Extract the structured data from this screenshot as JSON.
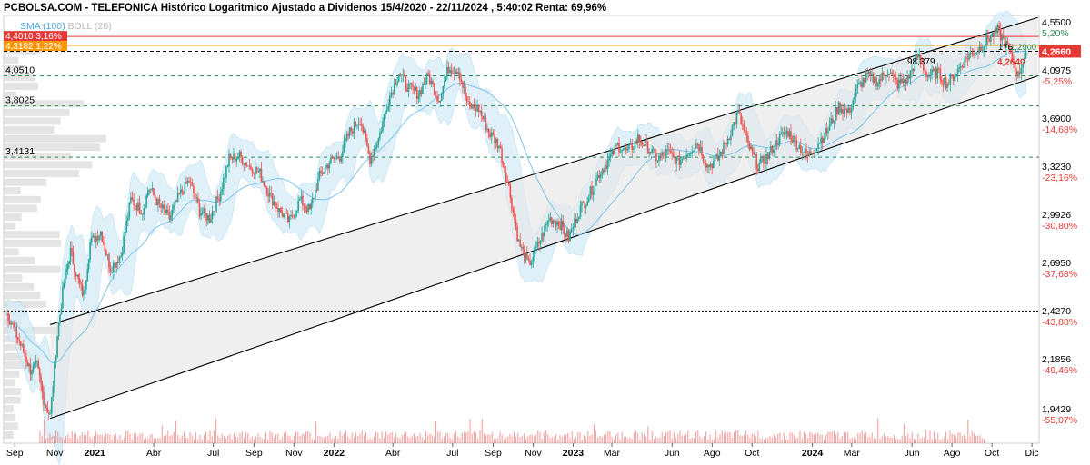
{
  "title": "PCBOLSA.COM - TELEFONICA Histórico Logaritmico Ajustado a Dividenos 15/4/2020 - 22/11/2024 , 5:40:02 Renta: 69,96%",
  "legend": {
    "sma": "SMA (100)",
    "boll": "BOLL (20)"
  },
  "colors": {
    "up": "#26a69a",
    "down": "#ef5350",
    "sma": "#7cc4ec",
    "boll_fill": "#d6ecf8",
    "channel_fill": "#e6e6e6",
    "channel_line": "#000000",
    "support_line": "#2e8b57",
    "resistance_line": "#e53935",
    "orange_label": "#ff9800",
    "last_price_bg": "#e53935",
    "volume": "#ef5350",
    "histogram": "#d9d9d9"
  },
  "chart_data": {
    "type": "candlestick",
    "scale": "log",
    "ylim": [
      1.87,
      4.6
    ],
    "x_tick_labels": [
      "Sep",
      "Nov",
      "2021",
      "Abr",
      "Jul",
      "Sep",
      "Nov",
      "2022",
      "Abr",
      "Jul",
      "Sep",
      "Nov",
      "2023",
      "Mar",
      "Jun",
      "Ago",
      "Oct",
      "2024",
      "Mar",
      "Jun",
      "Ago",
      "Oct",
      "Dic"
    ],
    "y_price_labels": [
      "4,5500",
      "4,0975",
      "3,6900",
      "3,3230",
      "2,9926",
      "2,6950",
      "2,4270",
      "2,1856",
      "1,9429"
    ],
    "y_pct_labels": [
      "5,20%",
      "-5,25%",
      "-14,68%",
      "-23,16%",
      "-30,80%",
      "-37,68%",
      "-43,88%",
      "-49,46%",
      "-55,07%"
    ],
    "left_level_labels": [
      "4,0510",
      "3,8025",
      "3,4131"
    ],
    "top_left_labels": [
      "4,4010  3,16%",
      "4,3182  1,22%"
    ],
    "last_price": "4,2660",
    "right_annotations": [
      "176",
      "1,2900",
      "4,2640"
    ],
    "mid_annotation": "98,379",
    "price_path": [
      [
        "2020-08-20",
        2.46
      ],
      [
        "2020-09-10",
        2.3
      ],
      [
        "2020-09-25",
        2.18
      ],
      [
        "2020-10-05",
        2.2
      ],
      [
        "2020-10-15",
        2.05
      ],
      [
        "2020-10-25",
        1.98
      ],
      [
        "2020-11-05",
        2.35
      ],
      [
        "2020-11-15",
        2.62
      ],
      [
        "2020-11-25",
        2.8
      ],
      [
        "2020-12-05",
        2.65
      ],
      [
        "2020-12-15",
        2.55
      ],
      [
        "2020-12-25",
        2.85
      ],
      [
        "2021-01-10",
        2.92
      ],
      [
        "2021-01-25",
        2.7
      ],
      [
        "2021-02-10",
        2.78
      ],
      [
        "2021-02-25",
        3.12
      ],
      [
        "2021-03-15",
        3.05
      ],
      [
        "2021-03-25",
        3.2
      ],
      [
        "2021-04-10",
        3.08
      ],
      [
        "2021-04-25",
        3.0
      ],
      [
        "2021-05-10",
        3.15
      ],
      [
        "2021-05-25",
        3.25
      ],
      [
        "2021-06-10",
        3.05
      ],
      [
        "2021-06-25",
        3.0
      ],
      [
        "2021-07-10",
        3.15
      ],
      [
        "2021-07-25",
        3.4
      ],
      [
        "2021-08-10",
        3.42
      ],
      [
        "2021-08-25",
        3.35
      ],
      [
        "2021-09-10",
        3.3
      ],
      [
        "2021-09-25",
        3.15
      ],
      [
        "2021-10-10",
        3.05
      ],
      [
        "2021-10-25",
        2.98
      ],
      [
        "2021-11-10",
        3.12
      ],
      [
        "2021-11-25",
        3.05
      ],
      [
        "2021-12-10",
        3.28
      ],
      [
        "2021-12-25",
        3.38
      ],
      [
        "2022-01-10",
        3.42
      ],
      [
        "2022-01-25",
        3.6
      ],
      [
        "2022-02-10",
        3.7
      ],
      [
        "2022-02-25",
        3.4
      ],
      [
        "2022-03-10",
        3.55
      ],
      [
        "2022-03-25",
        3.85
      ],
      [
        "2022-04-10",
        4.08
      ],
      [
        "2022-04-25",
        3.95
      ],
      [
        "2022-05-10",
        3.9
      ],
      [
        "2022-05-25",
        4.05
      ],
      [
        "2022-06-10",
        3.85
      ],
      [
        "2022-06-25",
        4.12
      ],
      [
        "2022-07-10",
        4.1
      ],
      [
        "2022-07-25",
        3.8
      ],
      [
        "2022-08-10",
        3.78
      ],
      [
        "2022-08-25",
        3.6
      ],
      [
        "2022-09-10",
        3.5
      ],
      [
        "2022-09-25",
        3.2
      ],
      [
        "2022-10-10",
        2.85
      ],
      [
        "2022-10-25",
        2.72
      ],
      [
        "2022-11-10",
        2.85
      ],
      [
        "2022-11-25",
        3.0
      ],
      [
        "2022-12-10",
        2.98
      ],
      [
        "2022-12-25",
        2.88
      ],
      [
        "2023-01-10",
        3.05
      ],
      [
        "2023-01-25",
        3.15
      ],
      [
        "2023-02-10",
        3.3
      ],
      [
        "2023-02-25",
        3.4
      ],
      [
        "2023-03-10",
        3.5
      ],
      [
        "2023-03-25",
        3.45
      ],
      [
        "2023-04-10",
        3.55
      ],
      [
        "2023-04-25",
        3.48
      ],
      [
        "2023-05-10",
        3.4
      ],
      [
        "2023-05-25",
        3.45
      ],
      [
        "2023-06-10",
        3.38
      ],
      [
        "2023-06-25",
        3.45
      ],
      [
        "2023-07-10",
        3.52
      ],
      [
        "2023-07-25",
        3.35
      ],
      [
        "2023-08-10",
        3.4
      ],
      [
        "2023-08-25",
        3.55
      ],
      [
        "2023-09-10",
        3.75
      ],
      [
        "2023-09-25",
        3.5
      ],
      [
        "2023-10-10",
        3.35
      ],
      [
        "2023-10-25",
        3.42
      ],
      [
        "2023-11-10",
        3.55
      ],
      [
        "2023-11-25",
        3.6
      ],
      [
        "2023-12-10",
        3.5
      ],
      [
        "2023-12-25",
        3.42
      ],
      [
        "2024-01-10",
        3.52
      ],
      [
        "2024-01-25",
        3.62
      ],
      [
        "2024-02-10",
        3.8
      ],
      [
        "2024-02-25",
        3.75
      ],
      [
        "2024-03-10",
        3.95
      ],
      [
        "2024-03-25",
        4.05
      ],
      [
        "2024-04-10",
        4.0
      ],
      [
        "2024-04-25",
        4.1
      ],
      [
        "2024-05-10",
        3.98
      ],
      [
        "2024-05-25",
        4.02
      ],
      [
        "2024-06-10",
        4.22
      ],
      [
        "2024-06-25",
        4.05
      ],
      [
        "2024-07-10",
        4.08
      ],
      [
        "2024-07-25",
        3.98
      ],
      [
        "2024-08-10",
        4.1
      ],
      [
        "2024-08-25",
        4.22
      ],
      [
        "2024-09-10",
        4.28
      ],
      [
        "2024-09-25",
        4.38
      ],
      [
        "2024-10-10",
        4.45
      ],
      [
        "2024-10-25",
        4.3
      ],
      [
        "2024-11-10",
        4.05
      ],
      [
        "2024-11-22",
        4.27
      ]
    ],
    "channel": {
      "lower": [
        [
          "2020-10-25",
          1.97
        ],
        [
          "2024-12-10",
          4.05
        ]
      ],
      "upper": [
        [
          "2020-10-25",
          2.4
        ],
        [
          "2024-12-10",
          4.58
        ]
      ]
    },
    "horizontal_levels": [
      {
        "value": 4.401,
        "style": "solid-red"
      },
      {
        "value": 4.3182,
        "style": "solid-orange"
      },
      {
        "value": 4.266,
        "style": "dashed-black"
      },
      {
        "value": 4.051,
        "style": "dashed-green"
      },
      {
        "value": 3.8025,
        "style": "dashed-green"
      },
      {
        "value": 3.4131,
        "style": "dashed-green"
      },
      {
        "value": 2.47,
        "style": "dotted-black"
      }
    ]
  }
}
